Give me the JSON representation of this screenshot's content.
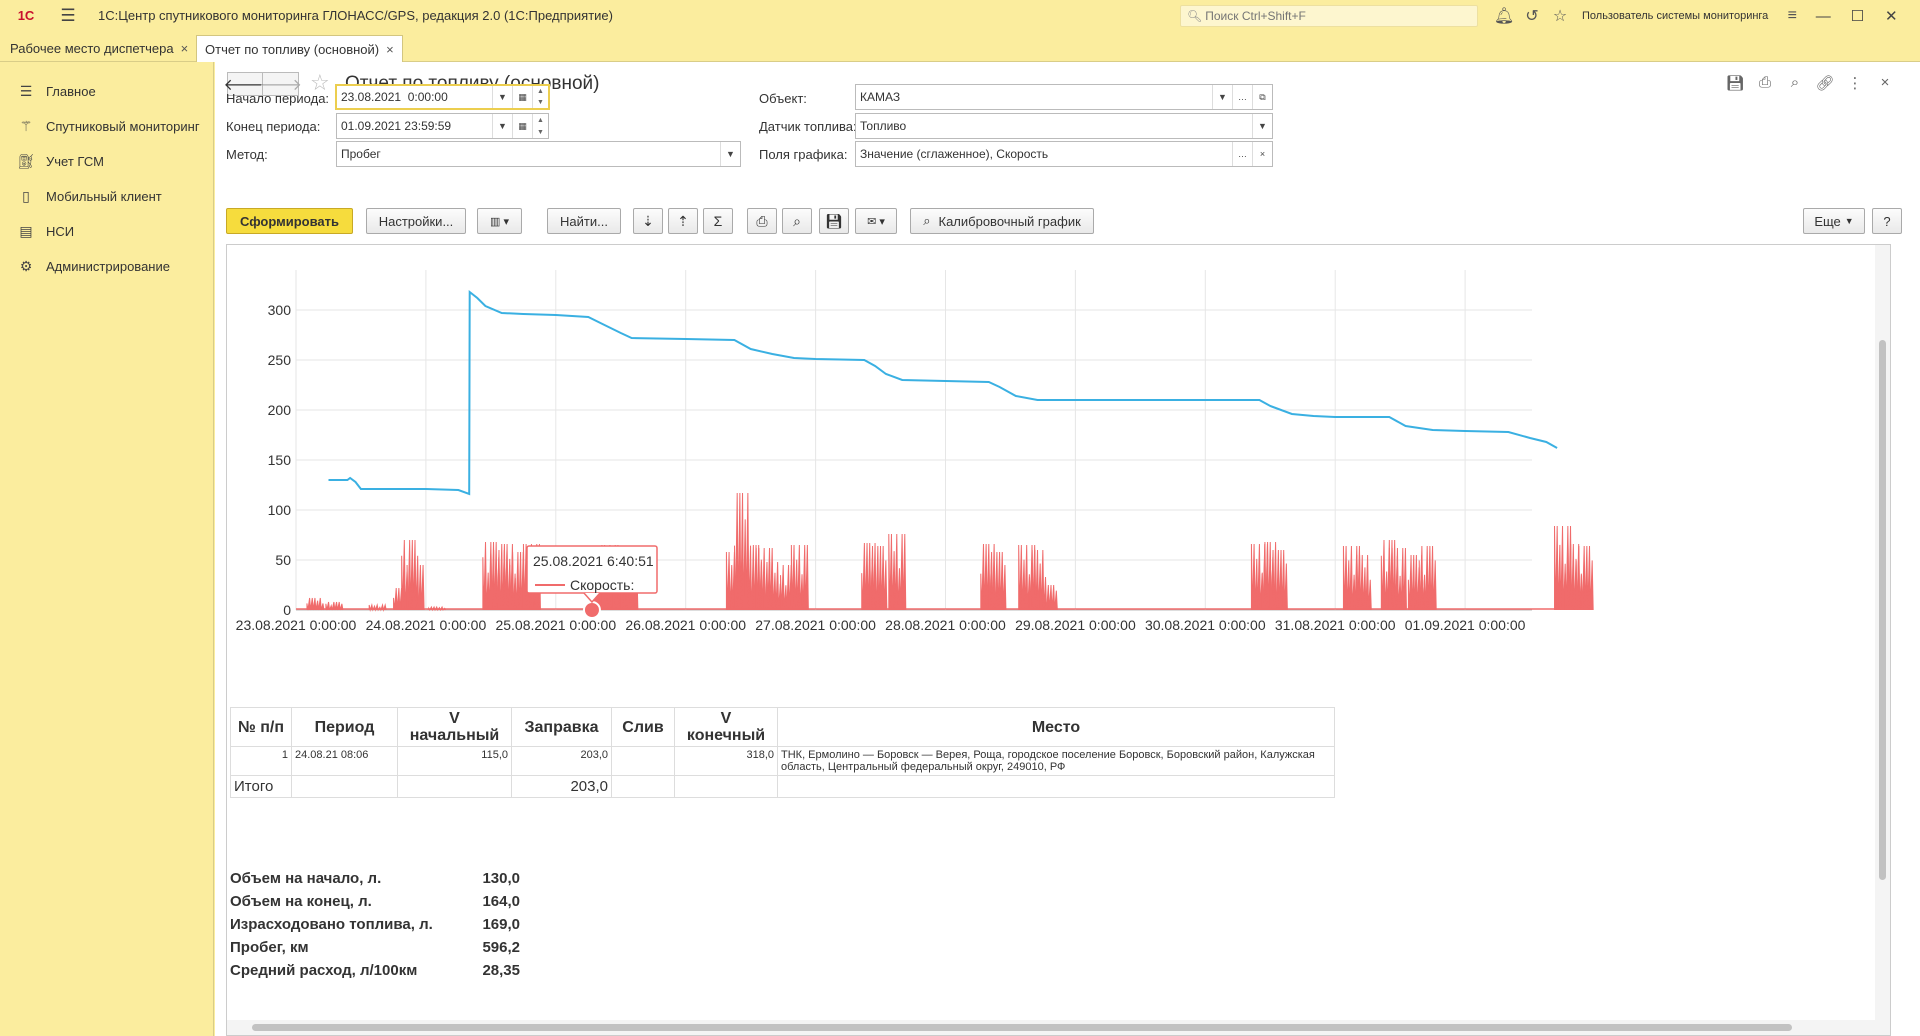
{
  "app": {
    "logo": "1С",
    "title": "1С:Центр спутникового мониторинга ГЛОНАСС/GPS, редакция 2.0  (1С:Предприятие)",
    "search_placeholder": "Поиск Ctrl+Shift+F",
    "user": "Пользователь системы мониторинга"
  },
  "tabs": [
    {
      "label": "Рабочее место диспетчера"
    },
    {
      "label": "Отчет по топливу (основной)"
    }
  ],
  "sidebar": {
    "items": [
      {
        "label": "Главное",
        "icon": "menu-lines-icon"
      },
      {
        "label": "Спутниковый мониторинг",
        "icon": "satellite-icon"
      },
      {
        "label": "Учет ГСМ",
        "icon": "fuel-pump-icon"
      },
      {
        "label": "Мобильный клиент",
        "icon": "mobile-phone-icon"
      },
      {
        "label": "НСИ",
        "icon": "books-icon"
      },
      {
        "label": "Администрирование",
        "icon": "gear-icon"
      }
    ]
  },
  "form": {
    "title": "Отчет по топливу (основной)",
    "start_label": "Начало периода:",
    "start_value": "23.08.2021  0:00:00",
    "end_label": "Конец периода:",
    "end_value": "01.09.2021 23:59:59",
    "method_label": "Метод:",
    "method_value": "Пробег",
    "object_label": "Объект:",
    "object_value": "КАМАЗ",
    "sensor_label": "Датчик топлива:",
    "sensor_value": "Топливо",
    "fields_label": "Поля графика:",
    "fields_value": "Значение (сглаженное), Скорость"
  },
  "toolbar": {
    "generate": "Сформировать",
    "settings": "Настройки...",
    "find": "Найти...",
    "calibration": "Калибровочный график",
    "more": "Еще",
    "help": "?"
  },
  "chart_data": {
    "type": "line",
    "ylim": [
      0,
      330
    ],
    "yticks": [
      "0",
      "50",
      "100",
      "150",
      "200",
      "250",
      "300"
    ],
    "xticks": [
      "23.08.2021 0:00:00",
      "24.08.2021 0:00:00",
      "25.08.2021 0:00:00",
      "26.08.2021 0:00:00",
      "27.08.2021 0:00:00",
      "28.08.2021 0:00:00",
      "29.08.2021 0:00:00",
      "30.08.2021 0:00:00",
      "31.08.2021 0:00:00",
      "01.09.2021 0:00:00"
    ],
    "grid": true,
    "series": [
      {
        "color": "#3ab0e2",
        "points": [
          [
            "23.08.2021 6:00",
            130
          ],
          [
            "23.08.2021 9:30",
            130
          ],
          [
            "23.08.2021 10:00",
            132
          ],
          [
            "23.08.2021 11:00",
            128
          ],
          [
            "23.08.2021 12:00",
            121
          ],
          [
            "24.08.2021 0:00",
            121
          ],
          [
            "24.08.2021 6:00",
            120
          ],
          [
            "24.08.2021 8:00",
            116
          ],
          [
            "24.08.2021 8:06",
            318
          ],
          [
            "24.08.2021 9:30",
            312
          ],
          [
            "24.08.2021 11:00",
            304
          ],
          [
            "24.08.2021 14:00",
            297
          ],
          [
            "24.08.2021 18:00",
            296
          ],
          [
            "25.08.2021 0:00",
            295
          ],
          [
            "25.08.2021 6:00",
            293
          ],
          [
            "25.08.2021 9:00",
            285
          ],
          [
            "25.08.2021 12:00",
            277
          ],
          [
            "25.08.2021 14:00",
            272
          ],
          [
            "26.08.2021 0:00",
            271
          ],
          [
            "26.08.2021 9:00",
            270
          ],
          [
            "26.08.2021 12:00",
            261
          ],
          [
            "26.08.2021 16:00",
            256
          ],
          [
            "26.08.2021 20:00",
            252
          ],
          [
            "27.08.2021 0:00",
            251
          ],
          [
            "27.08.2021 9:00",
            250
          ],
          [
            "27.08.2021 11:00",
            244
          ],
          [
            "27.08.2021 13:00",
            236
          ],
          [
            "27.08.2021 16:00",
            230
          ],
          [
            "28.08.2021 0:00",
            229
          ],
          [
            "28.08.2021 8:00",
            228
          ],
          [
            "28.08.2021 10:00",
            223
          ],
          [
            "28.08.2021 13:00",
            214
          ],
          [
            "28.08.2021 17:00",
            210
          ],
          [
            "29.08.2021 0:00",
            210
          ],
          [
            "30.08.2021 0:00",
            210
          ],
          [
            "30.08.2021 10:00",
            210
          ],
          [
            "30.08.2021 12:00",
            204
          ],
          [
            "30.08.2021 16:00",
            196
          ],
          [
            "30.08.2021 20:00",
            194
          ],
          [
            "31.08.2021 0:00",
            193
          ],
          [
            "31.08.2021 10:00",
            193
          ],
          [
            "31.08.2021 13:00",
            184
          ],
          [
            "31.08.2021 18:00",
            180
          ],
          [
            "01.09.2021 0:00",
            179
          ],
          [
            "01.09.2021 8:00",
            178
          ],
          [
            "01.09.2021 12:00",
            172
          ],
          [
            "01.09.2021 15:00",
            168
          ],
          [
            "01.09.2021 17:00",
            162
          ]
        ]
      },
      {
        "color": "#f06b6b",
        "bursts": [
          [
            "23.08.2021 3:30",
            12
          ],
          [
            "23.08.2021 7:00",
            8
          ],
          [
            "23.08.2021 15:00",
            5
          ],
          [
            "23.08.2021 19:30",
            22
          ],
          [
            "23.08.2021 21:00",
            70
          ],
          [
            "23.08.2021 22:00",
            45
          ],
          [
            "24.08.2021 2:00",
            3
          ],
          [
            "24.08.2021 12:00",
            68
          ],
          [
            "24.08.2021 13:30",
            60
          ],
          [
            "24.08.2021 15:00",
            66
          ],
          [
            "24.08.2021 17:00",
            58
          ],
          [
            "24.08.2021 19:30",
            66
          ],
          [
            "25.08.2021 6:40",
            0
          ],
          [
            "25.08.2021 8:00",
            62
          ],
          [
            "25.08.2021 10:00",
            65
          ],
          [
            "25.08.2021 12:00",
            63
          ],
          [
            "25.08.2021 13:30",
            55
          ],
          [
            "26.08.2021 9:00",
            58
          ],
          [
            "26.08.2021 10:30",
            117
          ],
          [
            "26.08.2021 12:30",
            65
          ],
          [
            "26.08.2021 14:30",
            62
          ],
          [
            "26.08.2021 16:00",
            48
          ],
          [
            "26.08.2021 19:00",
            45
          ],
          [
            "26.08.2021 21:00",
            65
          ],
          [
            "27.08.2021 10:00",
            67
          ],
          [
            "27.08.2021 11:30",
            64
          ],
          [
            "27.08.2021 15:00",
            76
          ],
          [
            "28.08.2021 8:00",
            66
          ],
          [
            "28.08.2021 9:30",
            58
          ],
          [
            "28.08.2021 15:00",
            65
          ],
          [
            "28.08.2021 17:00",
            60
          ],
          [
            "28.08.2021 19:00",
            25
          ],
          [
            "30.08.2021 10:00",
            66
          ],
          [
            "30.08.2021 12:00",
            68
          ],
          [
            "30.08.2021 13:30",
            60
          ],
          [
            "31.08.2021 3:00",
            64
          ],
          [
            "31.08.2021 5:00",
            55
          ],
          [
            "31.08.2021 10:00",
            70
          ],
          [
            "31.08.2021 11:30",
            62
          ],
          [
            "31.08.2021 15:00",
            55
          ],
          [
            "31.08.2021 17:00",
            64
          ],
          [
            "01.09.2021 18:00",
            84
          ],
          [
            "01.09.2021 20:00",
            66
          ],
          [
            "01.09.2021 22:00",
            64
          ]
        ]
      }
    ],
    "tooltip": {
      "date": "25.08.2021 6:40:51",
      "label": "Скорость:"
    }
  },
  "table": {
    "headers": [
      "№ п/п",
      "Период",
      "V\nначальный",
      "Заправка",
      "Слив",
      "V\nконечный",
      "Место"
    ],
    "rows": [
      {
        "n": "1",
        "period": "24.08.21 08:06",
        "v_start": "115,0",
        "refuel": "203,0",
        "drain": "",
        "v_end": "318,0",
        "place": "ТНК, Ермолино — Боровск — Верея, Роща, городское поселение Боровск, Боровский район, Калужская область, Центральный федеральный округ, 249010, РФ"
      }
    ],
    "total_label": "Итого",
    "total_refuel": "203,0"
  },
  "summary": [
    {
      "k": "Объем на начало, л.",
      "v": "130,0"
    },
    {
      "k": "Объем на конец, л.",
      "v": "164,0"
    },
    {
      "k": "Израсходовано топлива, л.",
      "v": "169,0"
    },
    {
      "k": "Пробег, км",
      "v": "596,2"
    },
    {
      "k": "Средний расход, л/100км",
      "v": "28,35"
    }
  ]
}
